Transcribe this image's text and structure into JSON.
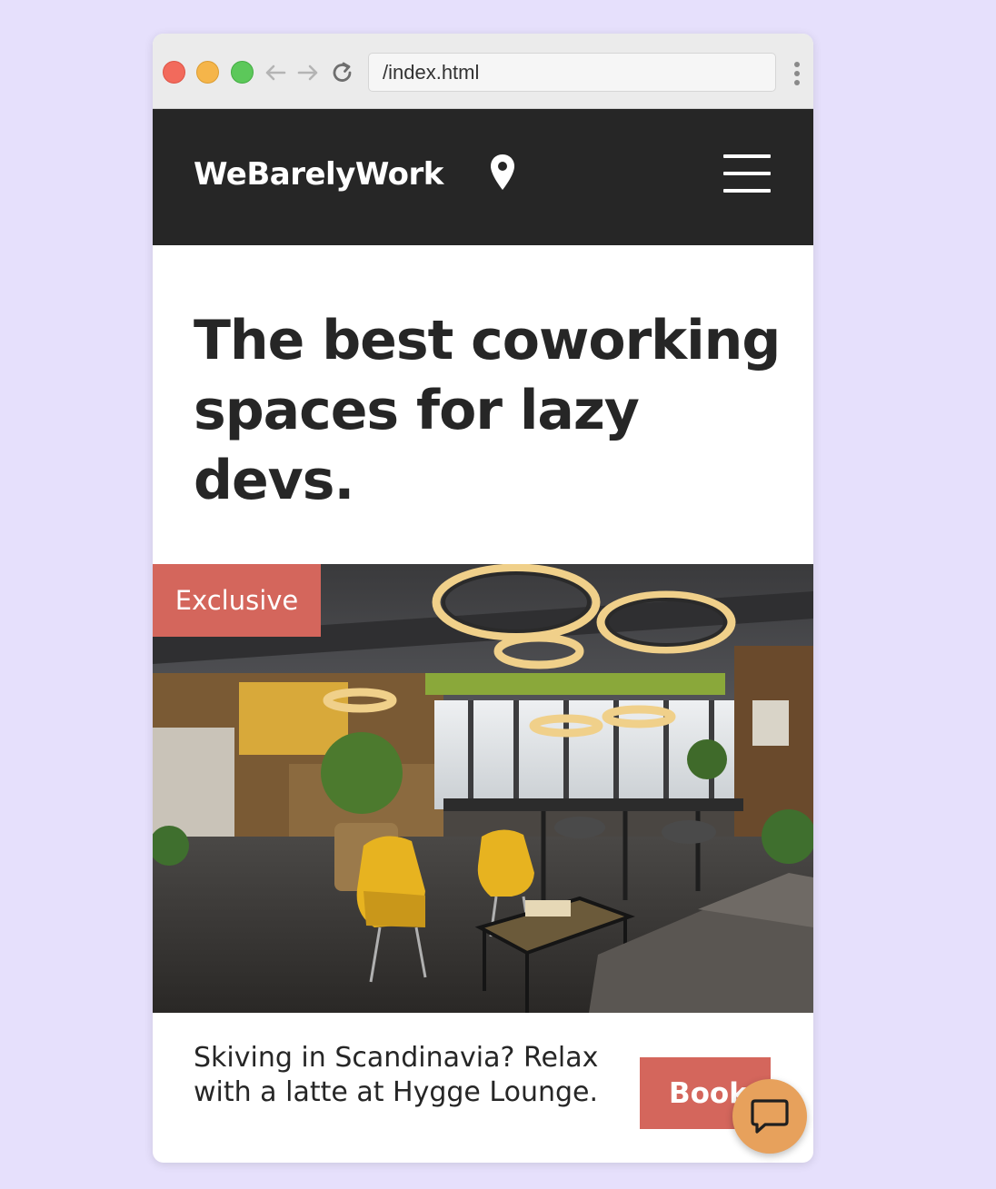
{
  "browser": {
    "url": "/index.html",
    "colors": {
      "close": "#f26a5c",
      "minimize": "#f5b54a",
      "maximize": "#5cc85a"
    }
  },
  "header": {
    "brand": "WeBarelyWork",
    "location_icon": "map-pin-icon",
    "menu_icon": "hamburger-menu-icon",
    "background": "#262626"
  },
  "hero": {
    "title": "The best coworking spaces for lazy devs."
  },
  "featured": {
    "badge": "Exclusive",
    "image_subject": "coworking lounge with yellow armchairs and ring lights",
    "description": "Skiving in Scandinavia? Relax with a latte at Hygge Lounge.",
    "button_label": "Book",
    "accent": "#d4665c"
  },
  "chat": {
    "icon": "chat-bubble-icon",
    "color": "#e7a15c"
  }
}
